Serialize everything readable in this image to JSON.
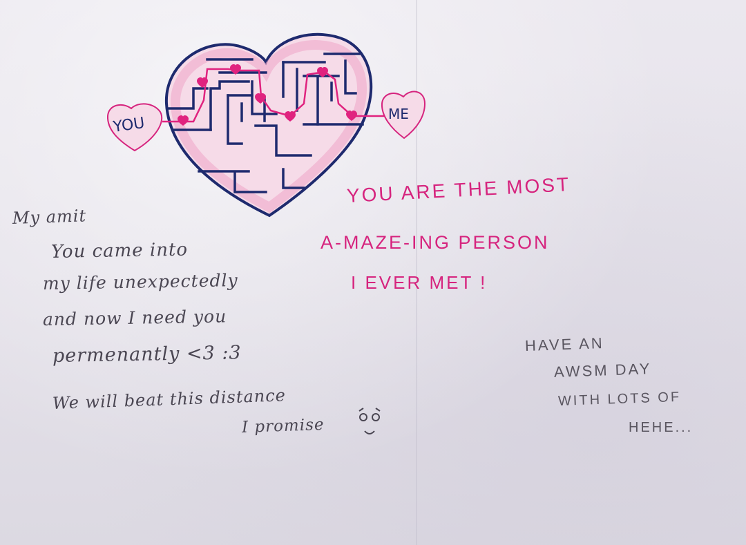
{
  "maze": {
    "left_tag": "YOU",
    "right_tag": "ME",
    "colors": {
      "outline": "#1e2a6e",
      "fill": "#f3b8d2",
      "hearts": "#e0237f",
      "path": "#e0237f"
    }
  },
  "letter": {
    "salutation": "My amit",
    "lines": [
      "You came into",
      "my life unexpectedly",
      "and now I need you",
      "permenantly <3 :3",
      "We will beat this distance",
      "I promise"
    ]
  },
  "tagline": {
    "lines": [
      "YOU ARE THE MOST",
      "A-MAZE-ING  PERSON",
      "I EVER MET !"
    ]
  },
  "wish": {
    "lines": [
      "HAVE AN",
      "AWSM DAY",
      "WITH LOTS OF",
      "HEHE..."
    ]
  },
  "icons": {
    "face": "smiley-face-icon"
  }
}
